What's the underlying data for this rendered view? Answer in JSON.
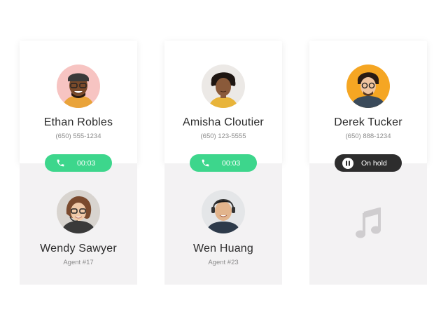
{
  "calls": [
    {
      "caller": {
        "name": "Ethan Robles",
        "phone": "(650) 555-1234",
        "avatar_bg": "#f7c4c2"
      },
      "status": {
        "type": "active",
        "label": "00:03",
        "icon": "phone-icon",
        "color": "#3dd68c"
      },
      "agent": {
        "name": "Wendy Sawyer",
        "id": "Agent #17"
      }
    },
    {
      "caller": {
        "name": "Amisha Cloutier",
        "phone": "(650) 123-5555",
        "avatar_bg": "#ece9e6"
      },
      "status": {
        "type": "active",
        "label": "00:03",
        "icon": "phone-icon",
        "color": "#3dd68c"
      },
      "agent": {
        "name": "Wen Huang",
        "id": "Agent #23"
      }
    },
    {
      "caller": {
        "name": "Derek Tucker",
        "phone": "(650) 888-1234",
        "avatar_bg": "#f5a623"
      },
      "status": {
        "type": "hold",
        "label": "On hold",
        "icon": "pause-icon",
        "color": "#2d2d2d"
      },
      "agent": {
        "icon": "music-note-icon"
      }
    }
  ]
}
